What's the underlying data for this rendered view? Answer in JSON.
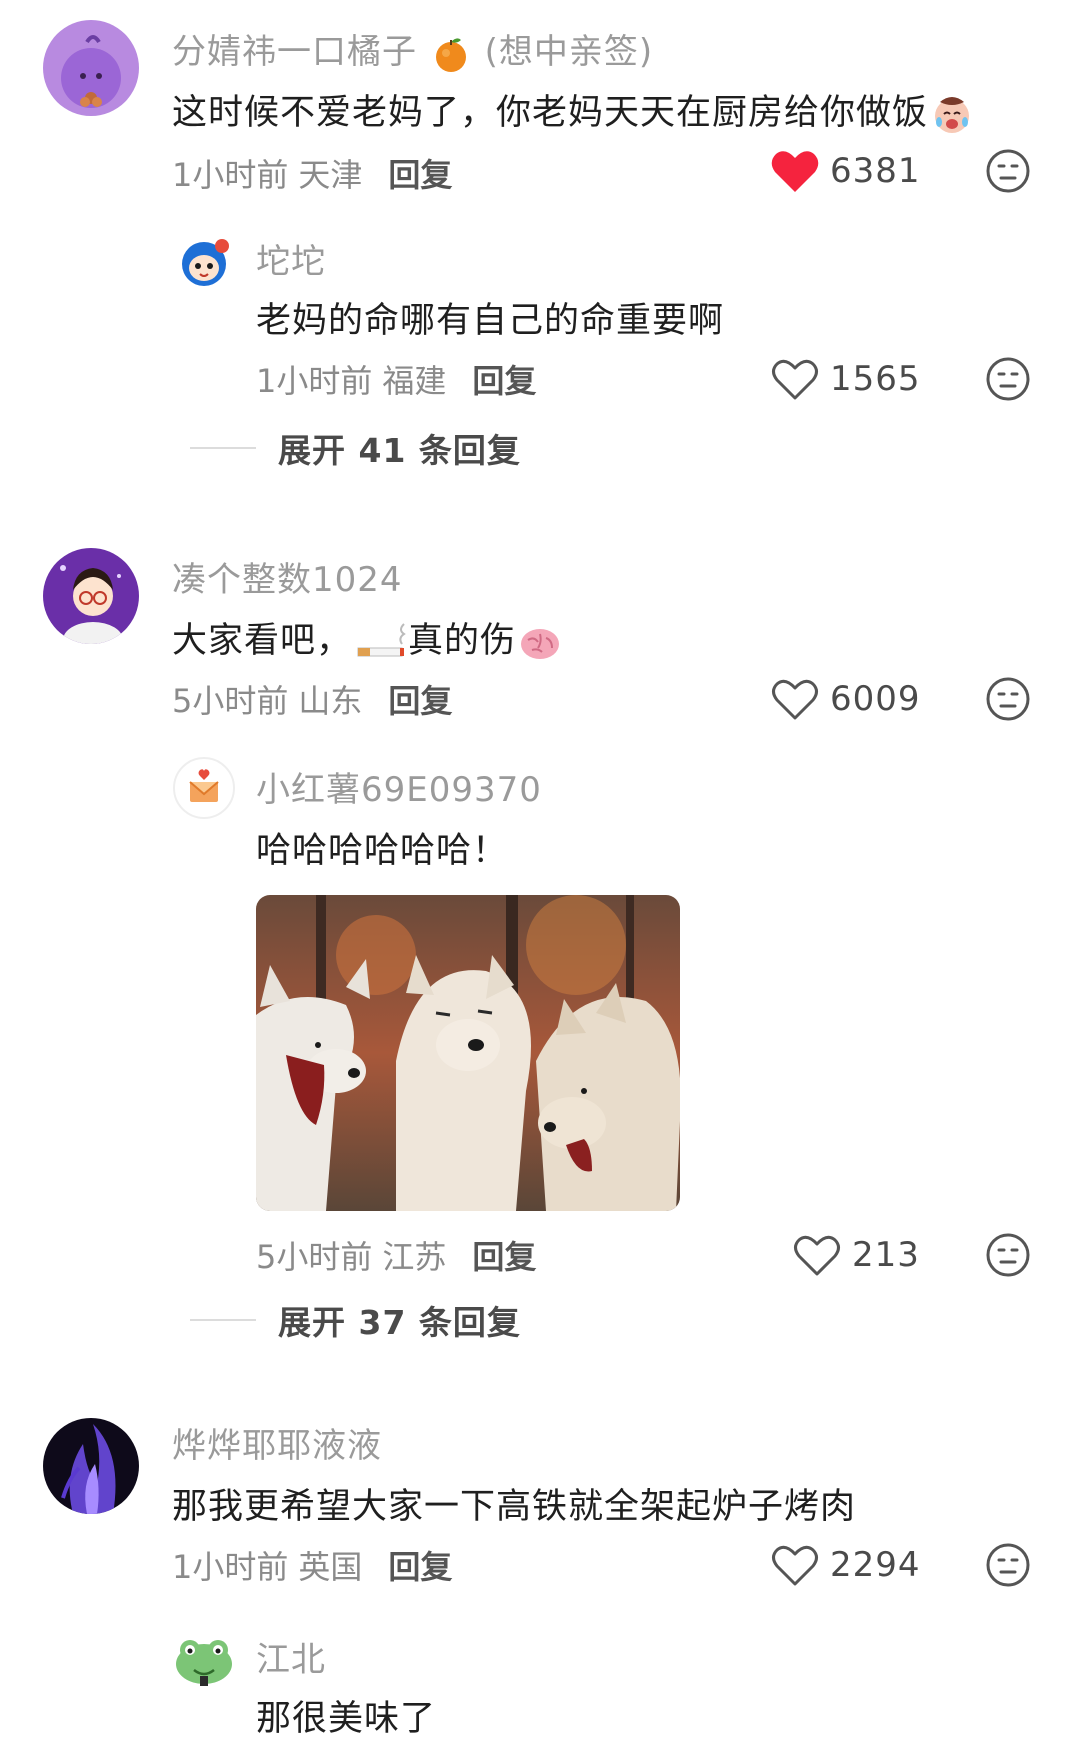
{
  "comments": [
    {
      "username": "分婧祎一口橘子",
      "username_suffix": "(想中亲签)",
      "text": "这时候不爱老妈了，你老妈天天在厨房给你做饭",
      "time": "1小时前",
      "location": "天津",
      "reply_label": "回复",
      "likes": "6381",
      "liked": true,
      "reply": {
        "username": "坨坨",
        "text": "老妈的命哪有自己的命重要啊",
        "time": "1小时前",
        "location": "福建",
        "reply_label": "回复",
        "likes": "1565"
      },
      "expand_label": "展开 41 条回复"
    },
    {
      "username": "凑个整数1024",
      "text_before": "大家看吧，",
      "text_after": "真的伤",
      "time": "5小时前",
      "location": "山东",
      "reply_label": "回复",
      "likes": "6009",
      "reply": {
        "username": "小红薯69E09370",
        "text": "哈哈哈哈哈哈！",
        "time": "5小时前",
        "location": "江苏",
        "reply_label": "回复",
        "likes": "213"
      },
      "expand_label": "展开 37 条回复"
    },
    {
      "username": "烨烨耶耶液液",
      "text": "那我更希望大家一下高铁就全架起炉子烤肉",
      "time": "1小时前",
      "location": "英国",
      "reply_label": "回复",
      "likes": "2294",
      "reply": {
        "username": "江北",
        "text": "那很美味了"
      }
    }
  ],
  "icons": {
    "like_filled": "heart-filled-icon",
    "like_outline": "heart-outline-icon",
    "dislike": "dislike-face-icon",
    "orange_emoji": "orange-emoji",
    "crying_emoji": "crying-face-emoji",
    "cigarette_emoji": "cigarette-emoji",
    "brain_emoji": "brain-emoji"
  },
  "colors": {
    "heart_red": "#f5233e",
    "username_gray": "#9a9a9a",
    "text_dark": "#1f1f1f"
  }
}
